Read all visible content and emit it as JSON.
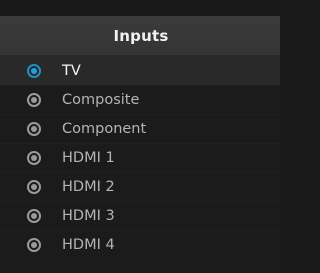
{
  "panel": {
    "title": "Inputs"
  },
  "inputs": {
    "selected_index": 0,
    "items": [
      {
        "label": "TV"
      },
      {
        "label": "Composite"
      },
      {
        "label": "Component"
      },
      {
        "label": "HDMI 1"
      },
      {
        "label": "HDMI 2"
      },
      {
        "label": "HDMI 3"
      },
      {
        "label": "HDMI 4"
      }
    ]
  },
  "colors": {
    "accent": "#25a0d9",
    "header_bg": "#383838",
    "panel_bg": "#1b1b1b",
    "selected_text": "#f5f5f5",
    "unselected_text": "#b4b4b4"
  },
  "icons": {
    "selected": "radio-selected-icon",
    "unselected": "radio-unselected-icon"
  }
}
